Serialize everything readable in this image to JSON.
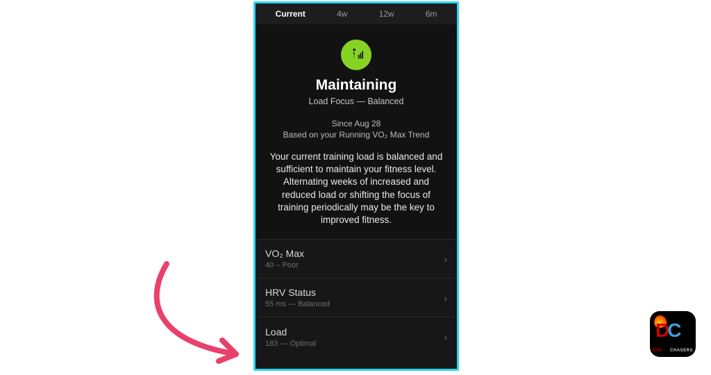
{
  "tabs": {
    "items": [
      "Current",
      "4w",
      "12w",
      "6m"
    ],
    "active_index": 0
  },
  "status": {
    "icon": "runner-bars-icon",
    "title": "Maintaining",
    "load_focus": "Load Focus — Balanced",
    "since": "Since Aug 28",
    "basis": "Based on your Running VO₂ Max Trend",
    "description": "Your current training load is balanced and sufficient to maintain your fitness level. Alternating weeks of increased and reduced load or shifting the focus of training periodically may be the key to improved fitness."
  },
  "metrics": [
    {
      "title": "VO₂ Max",
      "sub": "40 – Poor"
    },
    {
      "title": "HRV Status",
      "sub": "55 ms — Balanced"
    },
    {
      "title": "Load",
      "sub": "183 — Optimal"
    }
  ],
  "annotation": {
    "arrow_color": "#e9416b",
    "target": "Load"
  },
  "watermark": {
    "brand_main": "DC",
    "brand_left": "DIGI",
    "brand_right": "CHASERS"
  },
  "colors": {
    "frame": "#27d6f2",
    "badge": "#87d323",
    "bg": "#121212"
  }
}
